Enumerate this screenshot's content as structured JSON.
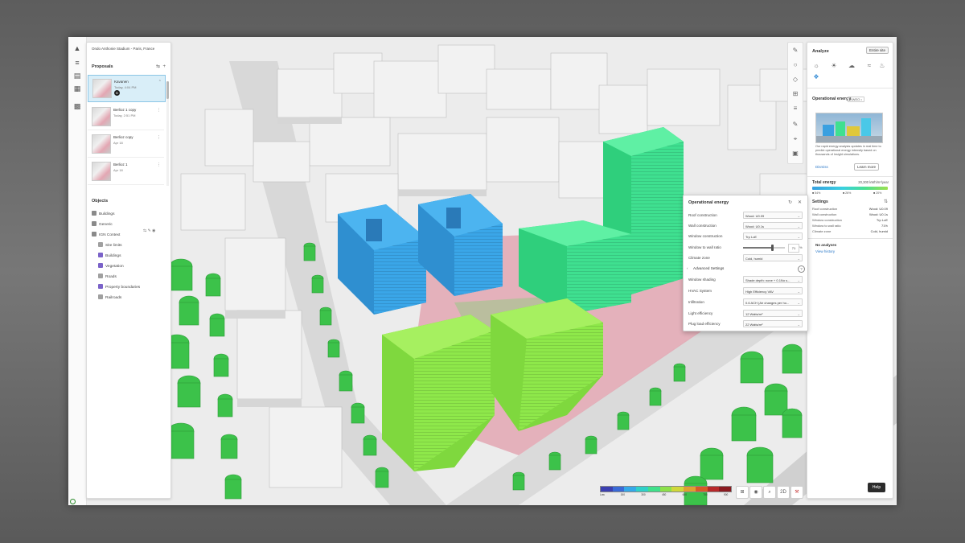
{
  "project": {
    "title": "Ondo Anthonie Stadium - Paris, France"
  },
  "proposals": {
    "heading": "Proposals",
    "items": [
      {
        "name": "Kavanen",
        "date": "Today, 4:04 PM",
        "badge": "B",
        "active": true
      },
      {
        "name": "Berlioz 1 copy",
        "date": "Today, 2:51 PM",
        "active": false
      },
      {
        "name": "Berlioz copy",
        "date": "Apr 18",
        "active": false
      },
      {
        "name": "Berlioz 1",
        "date": "Apr 18",
        "active": false
      }
    ]
  },
  "objects": {
    "heading": "Objects",
    "items": [
      {
        "label": "Buildings",
        "indent": 0,
        "color": "#8a8a8a"
      },
      {
        "label": "Generic",
        "indent": 0,
        "color": "#8a8a8a"
      },
      {
        "label": "IGN Context",
        "indent": 0,
        "color": "#8a8a8a"
      },
      {
        "label": "Site limits",
        "indent": 1,
        "color": "#a0a0a0"
      },
      {
        "label": "Buildings",
        "indent": 1,
        "color": "#7b63c9"
      },
      {
        "label": "Vegetation",
        "indent": 1,
        "color": "#7b63c9"
      },
      {
        "label": "Roads",
        "indent": 1,
        "color": "#a0a0a0"
      },
      {
        "label": "Property boundaries",
        "indent": 1,
        "color": "#7b63c9"
      },
      {
        "label": "Railroads",
        "indent": 1,
        "color": "#a0a0a0"
      }
    ]
  },
  "analyze": {
    "title": "Analyze",
    "site_button": "Entire site",
    "section": "Operational energy",
    "model_tag": "KWEO •",
    "description": "Our rapid energy analysis updates in real time to predict operational energy intensity based on thousands of Insight simulations.",
    "link": "Dismiss",
    "learn_more": "Learn more",
    "total_label": "Total energy",
    "total_value": "20,300 kWh/m²/year",
    "ticks": [
      "■ 54%",
      "■ 26%",
      "■ 20%"
    ],
    "settings_heading": "Settings",
    "settings": [
      {
        "k": "Roof construction",
        "v": "Wood: U0.09"
      },
      {
        "k": "Wall construction",
        "v": "Wood: U0.1s"
      },
      {
        "k": "Window construction",
        "v": "Trp LoE"
      },
      {
        "k": "Window to wall ratio",
        "v": "71%"
      },
      {
        "k": "Climate zone",
        "v": "Cold, humid"
      }
    ],
    "no_analyses": "No analyses",
    "view_history": "View history"
  },
  "popup": {
    "title": "Operational energy",
    "rows": [
      {
        "label": "Roof construction",
        "value": "Wood: U0.09"
      },
      {
        "label": "Wall construction",
        "value": "Wood: U0.1s"
      },
      {
        "label": "Window construction",
        "value": "Trp LoE"
      }
    ],
    "wwr_label": "Window to wall ratio",
    "wwr_value": "71",
    "wwr_unit": "%",
    "wwr_fraction": 0.71,
    "climate_label": "Climate zone",
    "climate_value": "Cold, humid",
    "advanced_label": "Advanced Settings",
    "adv_rows": [
      {
        "label": "Window shading",
        "value": "Shade depth: none + 0.1No s..."
      },
      {
        "label": "HVAC System",
        "value": "High Efficiency VAV"
      },
      {
        "label": "Infiltration",
        "value": "0.6 ACH (Air changes per ho..."
      },
      {
        "label": "Light efficiency",
        "value": "12 Watts/m²"
      },
      {
        "label": "Plug load efficiency",
        "value": "22 Watts/m²"
      }
    ]
  },
  "legend": {
    "colors": [
      "#3b3fb0",
      "#3a6ad6",
      "#35a8e8",
      "#2fd0c8",
      "#3fe08a",
      "#8ce04a",
      "#d0d83a",
      "#e0a030",
      "#d85a28",
      "#b8282a",
      "#8a1a20"
    ],
    "ticks": [
      "Low",
      "150",
      "300",
      "450",
      "600",
      "750",
      "900"
    ]
  },
  "view_controls": [
    "⊞",
    "◉",
    "⌕",
    "2D",
    "⚒"
  ],
  "help": {
    "label": "Help"
  },
  "colors": {
    "accent": "#2a78c8",
    "building_blue": "#3aa0e0",
    "building_green": "#37e08a",
    "building_lime": "#8ee84a",
    "site": "#e3a7b3"
  }
}
